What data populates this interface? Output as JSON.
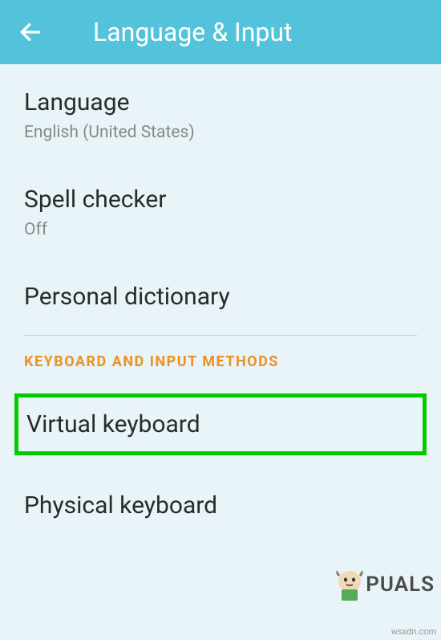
{
  "header": {
    "title": "Language & Input"
  },
  "settings": {
    "language": {
      "title": "Language",
      "subtitle": "English (United States) ‎"
    },
    "spellChecker": {
      "title": "Spell checker",
      "subtitle": "Off"
    },
    "personalDictionary": {
      "title": "Personal dictionary"
    }
  },
  "section": {
    "keyboardHeader": "KEYBOARD AND INPUT METHODS"
  },
  "keyboards": {
    "virtual": {
      "title": "Virtual keyboard"
    },
    "physical": {
      "title": "Physical keyboard"
    }
  },
  "watermark": {
    "text": "PUALS"
  },
  "source": "wsxdn.com"
}
